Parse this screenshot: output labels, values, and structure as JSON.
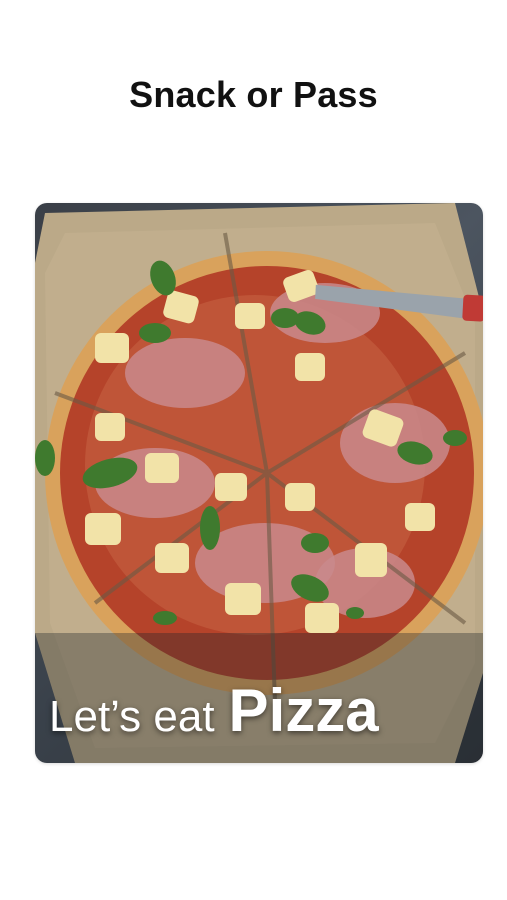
{
  "header": {
    "title": "Snack or Pass"
  },
  "card": {
    "caption_lead": "Let’s eat",
    "caption_food": "Pizza",
    "image_subject": "pizza-image"
  },
  "colors": {
    "background": "#ffffff",
    "title": "#111111",
    "caption": "#ffffff"
  }
}
